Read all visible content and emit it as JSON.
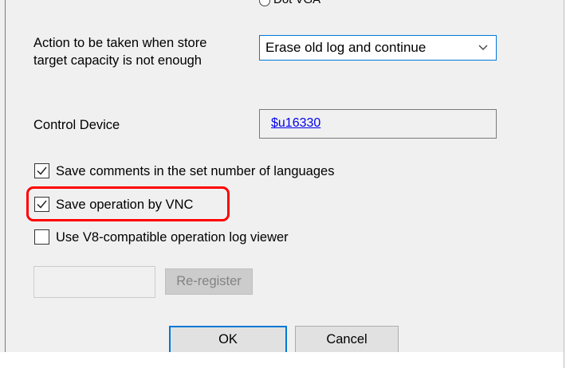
{
  "header": {
    "clipped_option_label": "Dot VGA"
  },
  "store_action": {
    "label_line1": "Action to be taken when store",
    "label_line2": "target capacity is not enough",
    "selected": "Erase old log and continue"
  },
  "control_device": {
    "label": "Control Device",
    "value": "$u16330"
  },
  "checkboxes": [
    {
      "label": "Save comments in the set number of languages",
      "checked": true
    },
    {
      "label": "Save operation by VNC",
      "checked": true
    },
    {
      "label": "Use V8-compatible operation log viewer",
      "checked": false
    }
  ],
  "reregister": {
    "button_label": "Re-register"
  },
  "footer": {
    "ok_label": "OK",
    "cancel_label": "Cancel"
  },
  "colors": {
    "highlight": "#ff0000",
    "focus": "#0078d7",
    "link": "#0000ee"
  }
}
